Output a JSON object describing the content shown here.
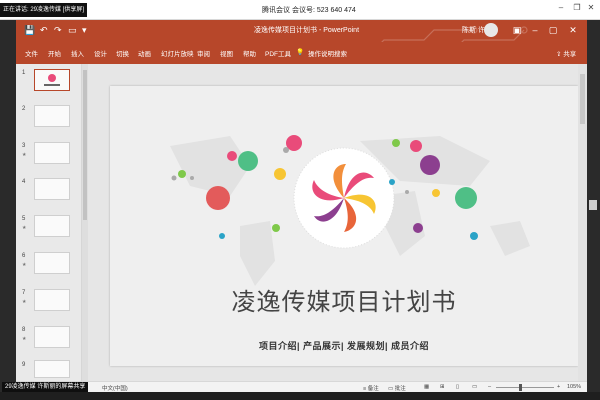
{
  "meeting": {
    "status": "正在讲话: 29凌逸传媒 [供享屏]",
    "title": "腾讯会议  会议号: 523 640 474"
  },
  "share_badge": "29凌逸传媒 许斯丽的屏幕共享",
  "window": {
    "title": "凌逸传媒项目计划书 - PowerPoint",
    "user_name": "陈斯 许",
    "share": "共享"
  },
  "ribbon": {
    "tabs": [
      "文件",
      "开始",
      "插入",
      "设计",
      "切换",
      "动画",
      "幻灯片放映",
      "审阅",
      "视图",
      "帮助",
      "PDF工具"
    ],
    "tell_me": "操作说明搜索"
  },
  "thumbnails": [
    {
      "num": "1"
    },
    {
      "num": "2"
    },
    {
      "num": "3"
    },
    {
      "num": "4"
    },
    {
      "num": "5"
    },
    {
      "num": "6"
    },
    {
      "num": "7"
    },
    {
      "num": "8"
    },
    {
      "num": "9"
    }
  ],
  "slide": {
    "title": "凌逸传媒项目计划书",
    "subtitle": "项目介绍|  产品展示|  发展规划|  成员介绍"
  },
  "status": {
    "language": "中文(中国)",
    "notes": "备注",
    "comments": "批注",
    "zoom": "105%"
  },
  "colors": {
    "accent": "#b7472a",
    "dot_colors": [
      "#e94b7a",
      "#9bd34a",
      "#f7c533",
      "#8c3f8f",
      "#2aa3c7",
      "#e35b5b",
      "#4fbf86",
      "#7fc94a"
    ]
  }
}
